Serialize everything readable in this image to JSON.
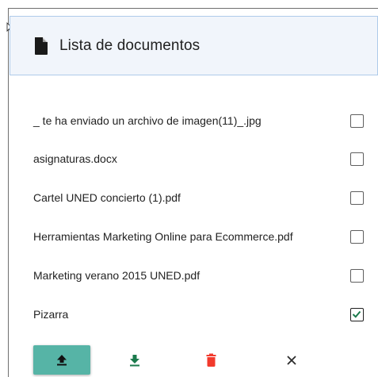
{
  "panel": {
    "title": "Lista de documentos",
    "title_icon": "file-icon"
  },
  "documents": [
    {
      "name": "_ te ha enviado un archivo de imagen(11)_.jpg",
      "checked": false
    },
    {
      "name": "asignaturas.docx",
      "checked": false
    },
    {
      "name": "Cartel UNED concierto (1).pdf",
      "checked": false
    },
    {
      "name": "Herramientas Marketing Online para Ecommerce.pdf",
      "checked": false
    },
    {
      "name": "Marketing verano 2015 UNED.pdf",
      "checked": false
    },
    {
      "name": "Pizarra",
      "checked": true
    }
  ],
  "toolbar": {
    "upload_icon": "upload-icon",
    "download_icon": "download-icon",
    "delete_icon": "trash-icon",
    "close_icon": "close-icon"
  },
  "colors": {
    "upload_button": "#56b4a6",
    "download_icon": "#1b7a4c",
    "delete_icon": "#f23a2c",
    "close_icon": "#2b2b2b",
    "header_background": "#f1f5fb",
    "header_border": "#aecbea",
    "checked_mark": "#1b7a4c"
  }
}
